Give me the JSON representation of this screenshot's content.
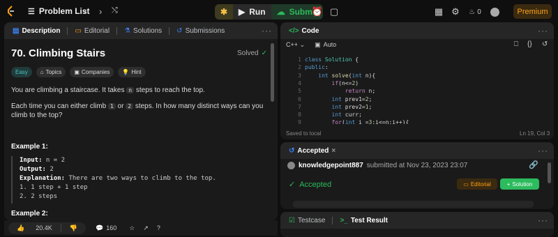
{
  "topbar": {
    "problem_list": "Problem List",
    "run": "Run",
    "submit": "Submit",
    "fire_count": "0",
    "premium": "Premium"
  },
  "left": {
    "tabs": [
      "Description",
      "Editorial",
      "Solutions",
      "Submissions"
    ],
    "title": "70. Climbing Stairs",
    "solved": "Solved",
    "tags": [
      "Easy",
      "Topics",
      "Companies",
      "Hint"
    ],
    "p1_pre": "You are climbing a staircase. It takes ",
    "p1_code": "n",
    "p1_post": " steps to reach the top.",
    "p2_pre": "Each time you can either climb ",
    "p2_c1": "1",
    "p2_mid": " or ",
    "p2_c2": "2",
    "p2_post": " steps. In how many distinct ways can you climb to the top?",
    "example1": "Example 1:",
    "ex_input_label": "Input:",
    "ex_input": " n = 2",
    "ex_output_label": "Output:",
    "ex_output": " 2",
    "ex_expl_label": "Explanation:",
    "ex_expl": " There are two ways to climb to the top.",
    "ex_line1": "1. 1 step + 1 step",
    "ex_line2": "2. 2 steps",
    "example2": "Example 2:",
    "likes": "20.4K",
    "comments": "160"
  },
  "code": {
    "title": "Code",
    "language": "C++",
    "auto": "Auto",
    "saved": "Saved to local",
    "cursor": "Ln 19, Col 3"
  },
  "accepted": {
    "tab": "Accepted",
    "user": "knowledgepoint887",
    "submitted": " submitted at Nov 23, 2023 23:07",
    "status": "Accepted",
    "editorial": "Editorial",
    "solution": "Solution"
  },
  "bottom": {
    "testcase": "Testcase",
    "result": "Test Result"
  }
}
